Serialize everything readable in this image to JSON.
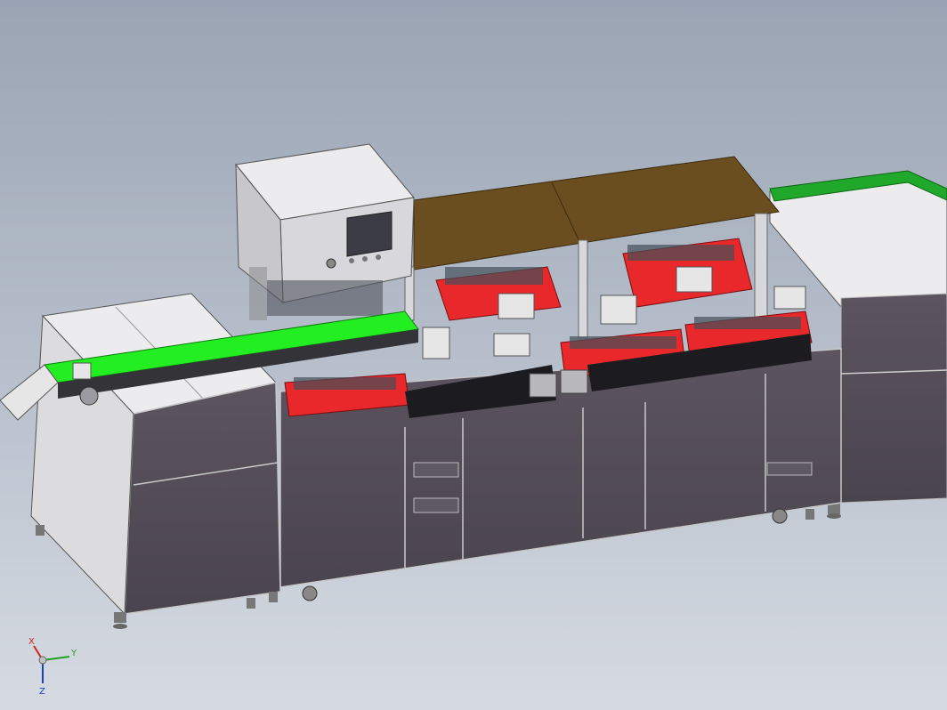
{
  "scene": {
    "background_top": "#9aa4b3",
    "background_bottom": "#d6dbe2",
    "model": {
      "frame_color": "#57505a",
      "cover_color": "#e8e8ea",
      "top_plate_color": "#6b4e1f",
      "conveyor_belt_color": "#22ee22",
      "fixture_color": "#e8282a",
      "guard_rail_color": "#1fa82a",
      "hmi_screen_color": "#3c3c46"
    }
  },
  "triad": {
    "x_label": "X",
    "y_label": "Y",
    "z_label": "Z",
    "x_color": "#d42020",
    "y_color": "#20a020",
    "z_color": "#2040c0"
  }
}
